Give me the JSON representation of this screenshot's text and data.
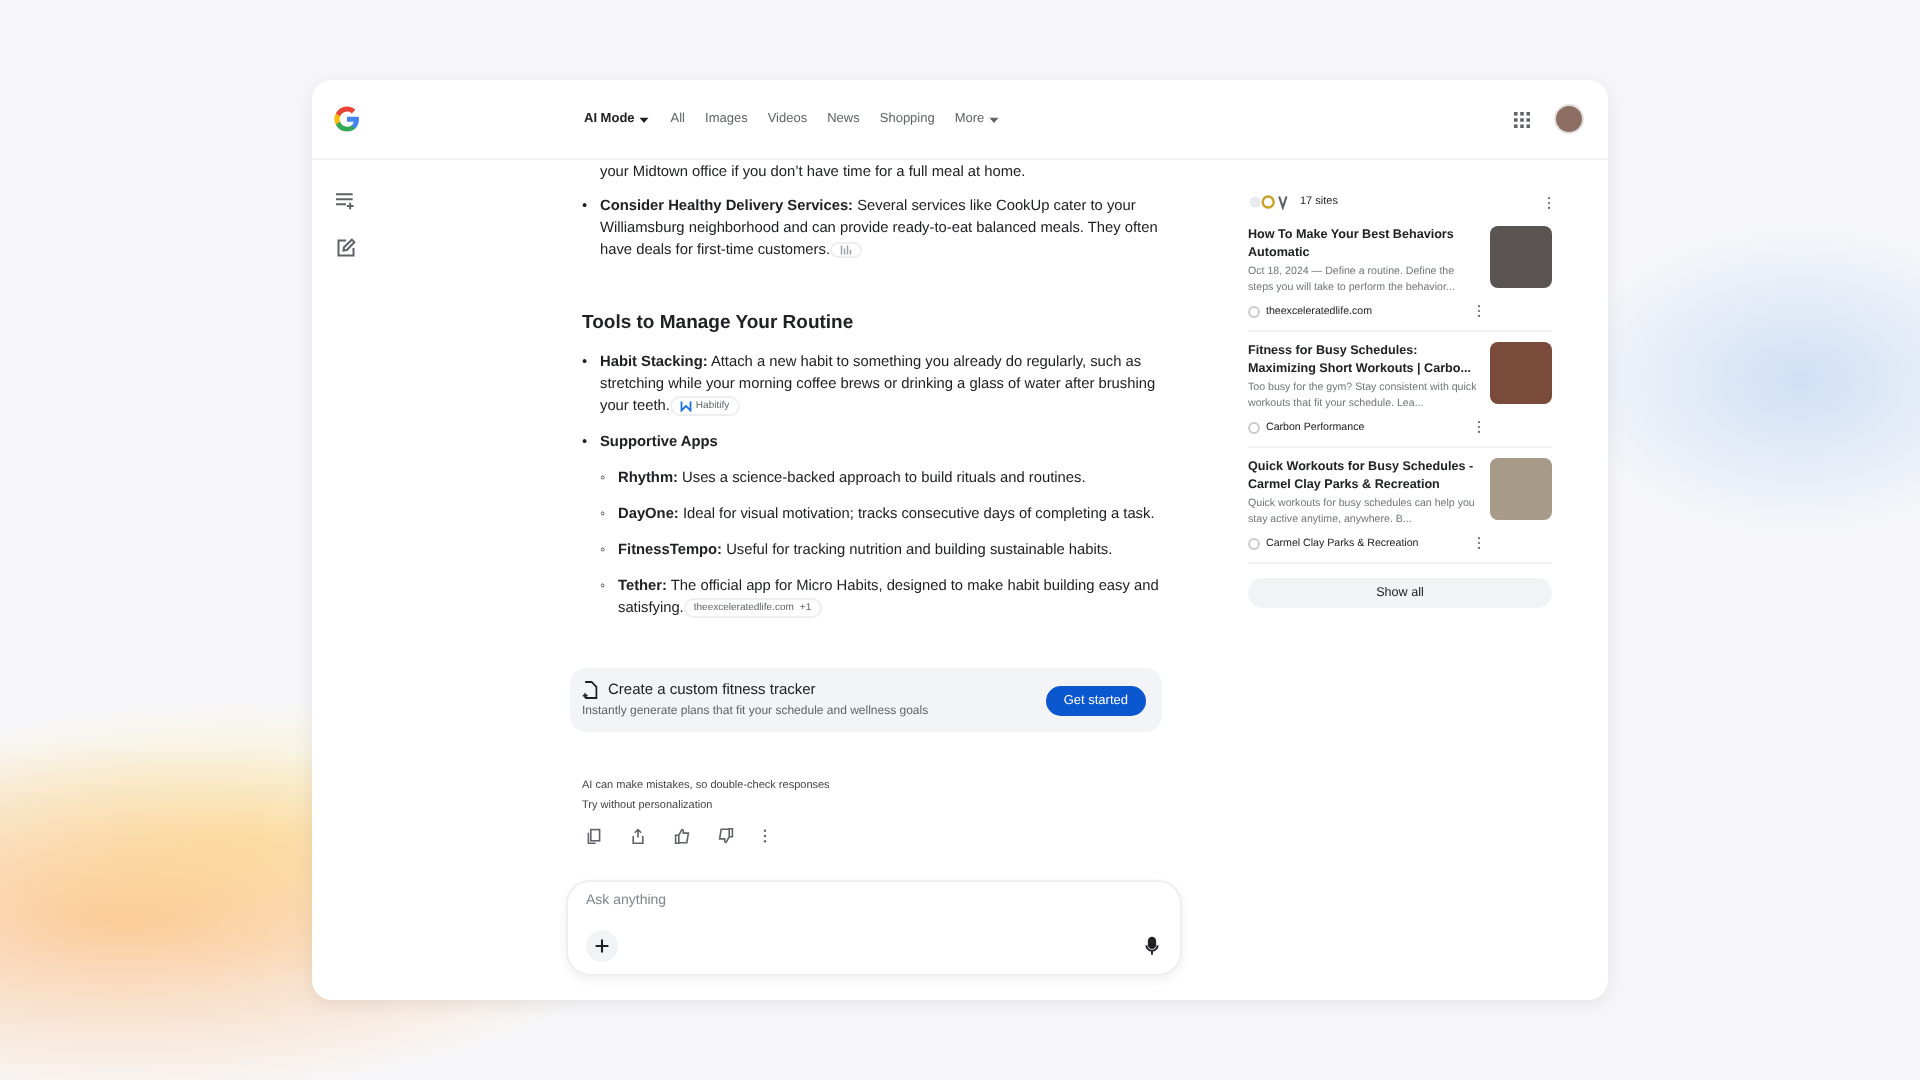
{
  "nav": {
    "tabs": [
      {
        "label": "AI Mode",
        "selected": true,
        "kind": "menu"
      },
      {
        "label": "All",
        "selected": false,
        "kind": "plain"
      },
      {
        "label": "Images",
        "selected": false,
        "kind": "plain"
      },
      {
        "label": "Videos",
        "selected": false,
        "kind": "plain"
      },
      {
        "label": "News",
        "selected": false,
        "kind": "plain"
      },
      {
        "label": "Shopping",
        "selected": false,
        "kind": "plain"
      },
      {
        "label": "More",
        "selected": false,
        "kind": "menu"
      }
    ]
  },
  "answer": {
    "lead_fragment": "your Midtown office if you don’t have time for a full meal at home.",
    "first_items": [
      {
        "marker": "•",
        "text": "**Consider Healthy Delivery Services:** Several services like CookUp cater to your Williamsburg neighborhood and can provide ready-to-eat balanced meals. They often have deals for first-time customers.",
        "chip": {
          "kind": "icon"
        }
      }
    ],
    "heading": "Tools to Manage Your Routine",
    "items": [
      {
        "marker": "•",
        "text": "**Habit Stacking:** Attach a new habit to something you already do regularly, such as stretching while your morning coffee brews or drinking a glass of water after brushing your teeth.",
        "chip": {
          "kind": "labeled",
          "label": "Habitify"
        }
      },
      {
        "marker": "•",
        "text": "**Supportive Apps**",
        "children": [
          {
            "marker": "◦",
            "text": "**Rhythm:** Uses a science-backed approach to build rituals and routines."
          },
          {
            "marker": "◦",
            "text": "**DayOne:** Ideal for visual motivation; tracks consecutive days of completing a task."
          },
          {
            "marker": "◦",
            "text": "**FitnessTempo:** Useful for tracking nutrition and building sustainable habits."
          },
          {
            "marker": "◦",
            "text": "**Tether:** The official app for Micro Habits, designed to make habit building easy and satisfying.",
            "chip": {
              "kind": "labeled",
              "label": "theexceleratedlife.com",
              "count": "+1"
            }
          }
        ]
      }
    ]
  },
  "promo": {
    "title": "Create a custom fitness tracker",
    "subtitle": "Instantly generate plans that fit your schedule and wellness goals",
    "button": "Get started"
  },
  "disclaimer": "AI can make mistakes, so double-check responses",
  "personalization_link": "Try without personalization",
  "input": {
    "placeholder": "Ask anything"
  },
  "sources": {
    "count": "17 sites",
    "cards": [
      {
        "title": "How To Make Your Best Behaviors Automatic",
        "snippet": "Oct 18, 2024 — Define a routine. Define the steps you will take to perform the behavior...",
        "site": "theexceleratedlife.com"
      },
      {
        "title": "Fitness for Busy Schedules: Maximizing Short Workouts | Carbo...",
        "snippet": "Too busy for the gym? Stay consistent with quick workouts that fit your schedule. Lea...",
        "site": "Carbon Performance"
      },
      {
        "title": "Quick Workouts for Busy Schedules - Carmel Clay Parks & Recreation",
        "snippet": "Quick workouts for busy schedules can help you stay active anytime, anywhere. B...",
        "site": "Carmel Clay Parks & Recreation"
      }
    ],
    "show_all": "Show all"
  }
}
